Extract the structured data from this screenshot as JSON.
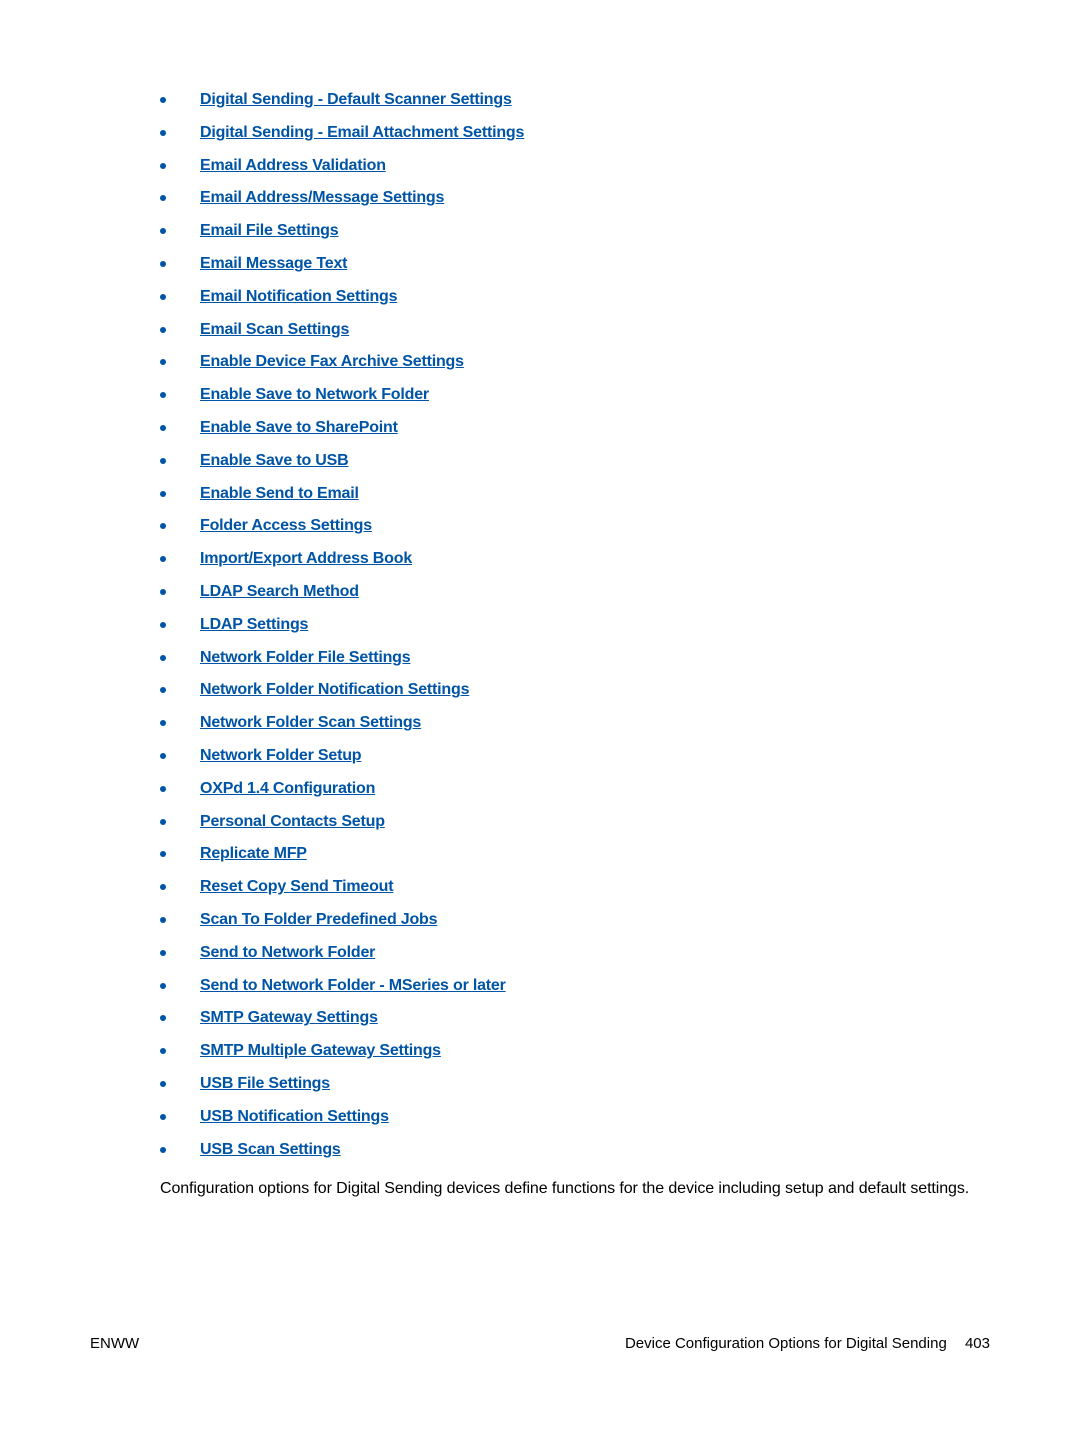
{
  "links": [
    "Digital Sending - Default Scanner Settings",
    "Digital Sending - Email Attachment Settings",
    "Email Address Validation",
    "Email Address/Message Settings",
    "Email File Settings",
    "Email Message Text",
    "Email Notification Settings",
    "Email Scan Settings",
    "Enable Device Fax Archive Settings",
    "Enable Save to Network Folder",
    "Enable Save to SharePoint",
    "Enable Save to USB",
    "Enable Send to Email",
    "Folder Access Settings",
    "Import/Export Address Book",
    "LDAP Search Method",
    "LDAP Settings",
    "Network Folder File Settings",
    "Network Folder Notification Settings",
    "Network Folder Scan Settings",
    "Network Folder Setup",
    "OXPd 1.4 Configuration",
    "Personal Contacts Setup",
    "Replicate MFP",
    "Reset Copy Send Timeout",
    "Scan To Folder Predefined Jobs",
    "Send to Network Folder",
    "Send to Network Folder - MSeries or later",
    "SMTP Gateway Settings",
    "SMTP Multiple Gateway Settings",
    "USB File Settings",
    "USB Notification Settings",
    "USB Scan Settings"
  ],
  "paragraph": "Configuration options for Digital Sending devices define functions for the device including setup and default settings.",
  "footer": {
    "left": "ENWW",
    "right_title": "Device Configuration Options for Digital Sending",
    "page": "403"
  }
}
